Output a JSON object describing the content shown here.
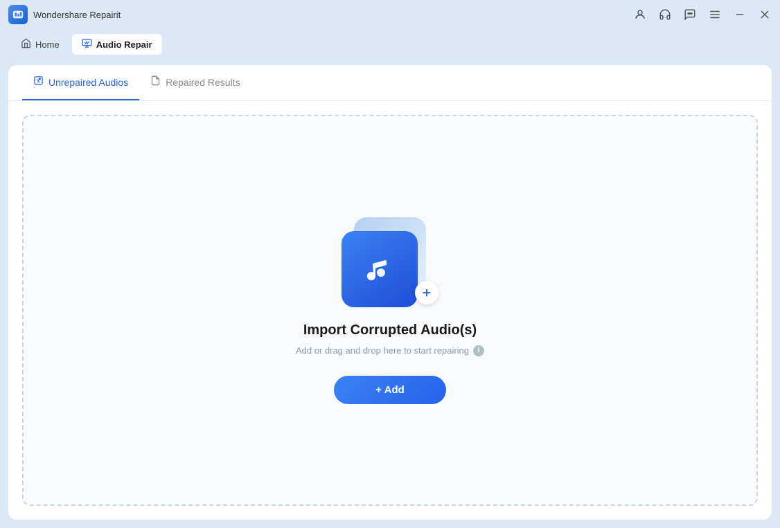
{
  "titlebar": {
    "app_name": "Wondershare Repairit"
  },
  "navbar": {
    "home_label": "Home",
    "active_label": "Audio Repair"
  },
  "tabs": [
    {
      "id": "unrepaired",
      "label": "Unrepaired Audios",
      "active": true
    },
    {
      "id": "repaired",
      "label": "Repaired Results",
      "active": false
    }
  ],
  "dropzone": {
    "title": "Import Corrupted Audio(s)",
    "subtitle": "Add or drag and drop here to start repairing",
    "add_button": "+ Add"
  }
}
